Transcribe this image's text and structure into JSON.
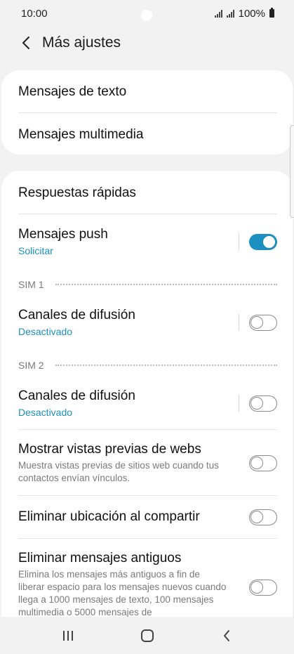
{
  "status": {
    "time": "10:00",
    "battery": "100%"
  },
  "header": {
    "title": "Más ajustes"
  },
  "card1": {
    "items": [
      {
        "title": "Mensajes de texto"
      },
      {
        "title": "Mensajes multimedia"
      }
    ]
  },
  "card2": {
    "quick_replies": {
      "title": "Respuestas rápidas"
    },
    "push": {
      "title": "Mensajes push",
      "sub": "Solicitar",
      "enabled": true
    },
    "sim1": {
      "label": "SIM 1"
    },
    "broadcast1": {
      "title": "Canales de difusión",
      "sub": "Desactivado",
      "enabled": false
    },
    "sim2": {
      "label": "SIM 2"
    },
    "broadcast2": {
      "title": "Canales de difusión",
      "sub": "Desactivado",
      "enabled": false
    },
    "web_previews": {
      "title": "Mostrar vistas previas de webs",
      "desc": "Muestra vistas previas de sitios web cuando tus contactos envían vínculos.",
      "enabled": false
    },
    "remove_location": {
      "title": "Eliminar ubicación al compartir",
      "enabled": false
    },
    "delete_old": {
      "title": "Eliminar mensajes antiguos",
      "desc": "Elimina los mensajes más antiguos a fin de liberar espacio para los mensajes nuevos cuando llega a 1000 mensajes de texto, 100 mensajes multimedia o 5000 mensajes de",
      "enabled": false
    }
  },
  "colors": {
    "accent": "#1b8fbf",
    "background": "#f2f2f2",
    "card": "#ffffff"
  },
  "icons": {
    "back": "chevron-left-icon",
    "recents": "recents-icon",
    "home": "home-icon",
    "nav_back": "nav-back-icon"
  }
}
